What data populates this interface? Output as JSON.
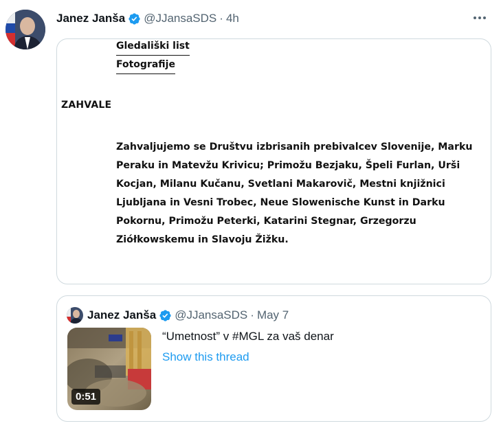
{
  "tweet": {
    "author_name": "Janez Janša",
    "handle": "@JJansaSDS",
    "separator": "·",
    "time": "4h"
  },
  "attached_image": {
    "links": [
      "Gledališki list",
      "Fotografije"
    ],
    "heading": "ZAHVALE",
    "body": "Zahvaljujemo se Društvu izbrisanih prebivalcev Slovenije, Marku Peraku in Matevžu Krivicu; Primožu Bezjaku, Špeli Furlan, Urši Kocjan, Milanu Kučanu, Svetlani Makarovič, Mestni knjižnici Ljubljana in Vesni Trobec, Neue Slowenische Kunst in Darku Pokornu, Primožu Peterki, Katarini Stegnar, Grzegorzu Ziółkowskemu in Slavoju Žižku."
  },
  "quoted_tweet": {
    "author_name": "Janez Janša",
    "handle": "@JJansaSDS",
    "separator": "·",
    "date": "May 7",
    "text": "“Umetnost” v #MGL za vaš denar",
    "show_thread": "Show this thread",
    "video_duration": "0:51"
  },
  "icons": {
    "verified": "verified-badge-icon",
    "more": "more-options-icon"
  },
  "colors": {
    "accent": "#1d9bf0",
    "muted": "#536471",
    "border": "#cfd9de"
  }
}
